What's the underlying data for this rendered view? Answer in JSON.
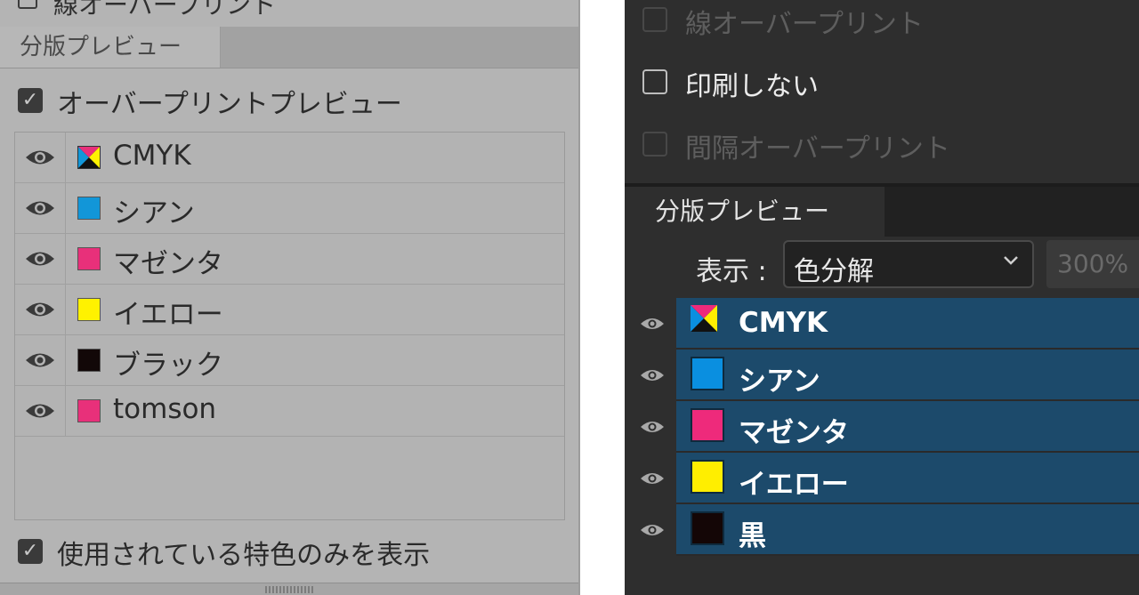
{
  "left_panel": {
    "top_cut_label": "線オーバープリント",
    "tab_label": "分版プレビュー",
    "overprint_preview": {
      "label": "オーバープリントプレビュー",
      "checked": true
    },
    "plates": [
      {
        "name": "CMYK",
        "color": "cmyk"
      },
      {
        "name": "シアン",
        "color": "#1296d8"
      },
      {
        "name": "マゼンタ",
        "color": "#e8307a"
      },
      {
        "name": "イエロー",
        "color": "#fff200"
      },
      {
        "name": "ブラック",
        "color": "#120808"
      },
      {
        "name": "tomson",
        "color": "#e8307a"
      }
    ],
    "used_spot_only": {
      "label": "使用されている特色のみを表示",
      "checked": true
    }
  },
  "right_panel": {
    "options": [
      {
        "label": "線オーバープリント",
        "checked": false,
        "enabled": false
      },
      {
        "label": "印刷しない",
        "checked": false,
        "enabled": true
      },
      {
        "label": "間隔オーバープリント",
        "checked": false,
        "enabled": false
      }
    ],
    "tab_label": "分版プレビュー",
    "display_label": "表示 :",
    "display_value": "色分解",
    "zoom_value": "300%",
    "plates": [
      {
        "name": "CMYK",
        "color": "cmyk"
      },
      {
        "name": "シアン",
        "color": "#0a8fe0"
      },
      {
        "name": "マゼンタ",
        "color": "#ee2a7b"
      },
      {
        "name": "イエロー",
        "color": "#ffee00"
      },
      {
        "name": "黒",
        "color": "#140606"
      }
    ],
    "selection_color": "#1c4a6b"
  },
  "icons": {
    "visibility": "eye-icon",
    "checkbox": "checkmark-icon",
    "dropdown": "chevron-down-icon",
    "composite_swatch": "cmyk-composite-icon"
  }
}
